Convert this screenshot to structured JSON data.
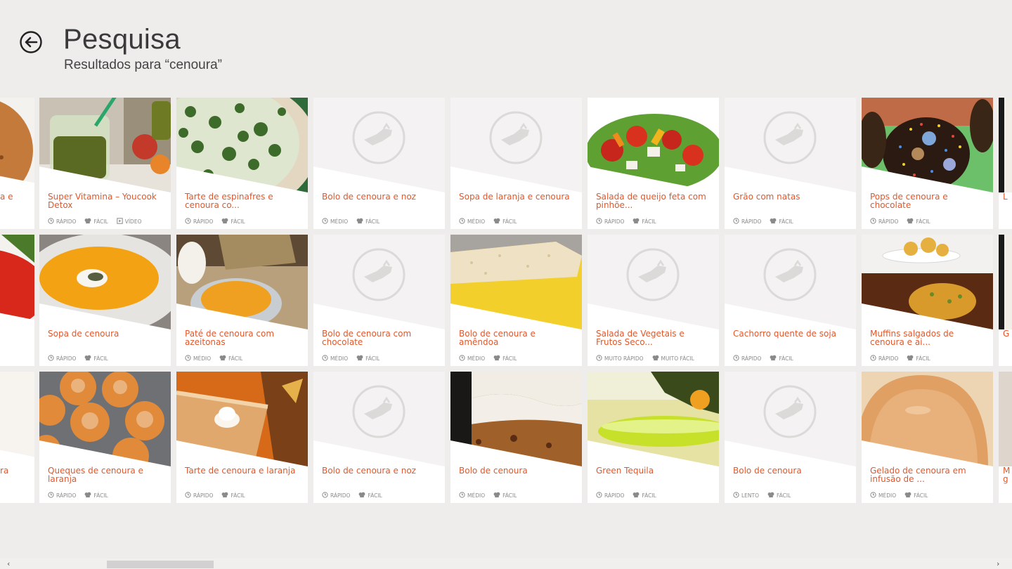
{
  "header": {
    "title": "Pesquisa",
    "subtitle": "Resultados para “cenoura”"
  },
  "colors": {
    "accent": "#e0582b",
    "background": "#efecec",
    "placeholder": "#f4f2f2",
    "meta_text": "#8a8a8a"
  },
  "partial_left": [
    {
      "name": "a e",
      "photo": "seeds-ball"
    },
    {
      "name": "",
      "photo": "tomato"
    },
    {
      "name": "ra",
      "photo": "plain"
    }
  ],
  "partial_right": [
    {
      "name": "L",
      "photo": "dark"
    },
    {
      "name": "G",
      "photo": "dark"
    },
    {
      "name": "M\ng",
      "photo": "light"
    }
  ],
  "recipes": [
    {
      "name": "Super Vitamina – Youcook Detox",
      "speed": "RÁPIDO",
      "difficulty": "FÁCIL",
      "extra": "VÍDEO",
      "photo": "green-juice"
    },
    {
      "name": "Sopa de cenoura",
      "speed": "RÁPIDO",
      "difficulty": "FÁCIL",
      "extra": "",
      "photo": "soup-bowl"
    },
    {
      "name": "Queques de cenoura e laranja",
      "speed": "RÁPIDO",
      "difficulty": "FÁCIL",
      "extra": "",
      "photo": "muffins"
    },
    {
      "name": "Tarte de espinafres e cenoura co...",
      "speed": "RÁPIDO",
      "difficulty": "FÁCIL",
      "extra": "",
      "photo": "spinach-tart"
    },
    {
      "name": "Paté de cenoura com azeitonas",
      "speed": "MÉDIO",
      "difficulty": "FÁCIL",
      "extra": "",
      "photo": "pate"
    },
    {
      "name": "Tarte de cenoura e laranja",
      "speed": "RÁPIDO",
      "difficulty": "FÁCIL",
      "extra": "",
      "photo": "orange-tart"
    },
    {
      "name": "Bolo de cenoura e noz",
      "speed": "MÉDIO",
      "difficulty": "FÁCIL",
      "extra": "",
      "photo": "placeholder"
    },
    {
      "name": "Bolo de cenoura com chocolate",
      "speed": "MÉDIO",
      "difficulty": "FÁCIL",
      "extra": "",
      "photo": "placeholder"
    },
    {
      "name": "Bolo de cenoura e noz",
      "speed": "RÁPIDO",
      "difficulty": "FÁCIL",
      "extra": "",
      "photo": "placeholder"
    },
    {
      "name": "Sopa de laranja e cenoura",
      "speed": "MÉDIO",
      "difficulty": "FÁCIL",
      "extra": "",
      "photo": "placeholder"
    },
    {
      "name": "Bolo de cenoura e amêndoa",
      "speed": "MÉDIO",
      "difficulty": "FÁCIL",
      "extra": "",
      "photo": "sponge-cake"
    },
    {
      "name": "Bolo de cenoura",
      "speed": "MÉDIO",
      "difficulty": "FÁCIL",
      "extra": "",
      "photo": "carrot-cake"
    },
    {
      "name": "Salada de queijo feta com pinhõe...",
      "speed": "RÁPIDO",
      "difficulty": "FÁCIL",
      "extra": "",
      "photo": "salad"
    },
    {
      "name": "Salada de Vegetais e Frutos Seco...",
      "speed": "MUITO RÁPIDO",
      "difficulty": "MUITO FÁCIL",
      "extra": "",
      "photo": "placeholder"
    },
    {
      "name": "Green Tequila",
      "speed": "RÁPIDO",
      "difficulty": "FÁCIL",
      "extra": "",
      "photo": "green-tequila"
    },
    {
      "name": "Grão com natas",
      "speed": "RÁPIDO",
      "difficulty": "FÁCIL",
      "extra": "",
      "photo": "placeholder"
    },
    {
      "name": "Cachorro quente de soja",
      "speed": "RÁPIDO",
      "difficulty": "FÁCIL",
      "extra": "",
      "photo": "placeholder"
    },
    {
      "name": "Bolo de cenoura",
      "speed": "LENTO",
      "difficulty": "FÁCIL",
      "extra": "",
      "photo": "placeholder"
    },
    {
      "name": "Pops de cenoura e chocolate",
      "speed": "RÁPIDO",
      "difficulty": "FÁCIL",
      "extra": "",
      "photo": "cake-pops"
    },
    {
      "name": "Muffins salgados de cenoura e ai...",
      "speed": "RÁPIDO",
      "difficulty": "FÁCIL",
      "extra": "",
      "photo": "savory-muffins"
    },
    {
      "name": "Gelado de cenoura em infusão de ...",
      "speed": "MÉDIO",
      "difficulty": "FÁCIL",
      "extra": "",
      "photo": "ice-cream"
    }
  ],
  "scroll": {
    "left_arrow": "‹",
    "right_arrow": "›",
    "position": 0.11
  }
}
